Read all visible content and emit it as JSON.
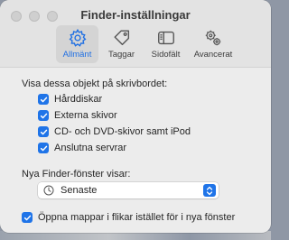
{
  "window": {
    "title": "Finder-inställningar"
  },
  "tabs": [
    {
      "label": "Allmänt",
      "icon": "gear-icon",
      "active": true
    },
    {
      "label": "Taggar",
      "icon": "tag-icon",
      "active": false
    },
    {
      "label": "Sidofält",
      "icon": "sidebar-icon",
      "active": false
    },
    {
      "label": "Avancerat",
      "icon": "gears-icon",
      "active": false
    }
  ],
  "desktop_section": {
    "heading": "Visa dessa objekt på skrivbordet:",
    "items": [
      {
        "label": "Hårddiskar",
        "checked": true
      },
      {
        "label": "Externa skivor",
        "checked": true
      },
      {
        "label": "CD- och DVD-skivor samt iPod",
        "checked": true
      },
      {
        "label": "Anslutna servrar",
        "checked": true
      }
    ]
  },
  "new_window": {
    "label": "Nya Finder-fönster visar:",
    "selected": "Senaste",
    "icon": "clock-icon"
  },
  "tabs_option": {
    "label": "Öppna mappar i flikar istället för i nya fönster",
    "checked": true
  },
  "colors": {
    "accent": "#1f74e8",
    "window_bg": "#ececec",
    "titlebar_bg": "#e3e3e3"
  }
}
